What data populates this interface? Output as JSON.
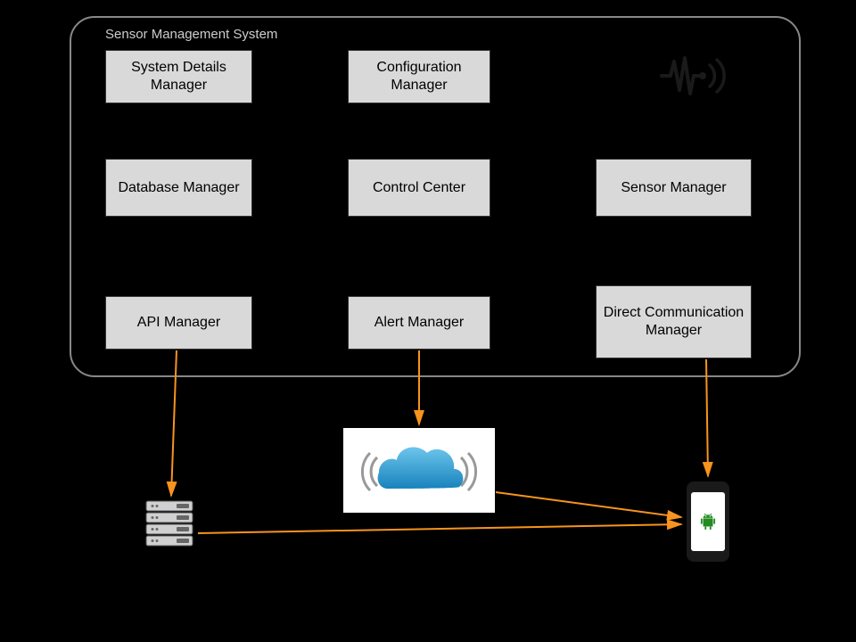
{
  "container": {
    "title": "Sensor Management System"
  },
  "boxes": {
    "system_details": "System Details Manager",
    "configuration": "Configuration Manager",
    "database": "Database Manager",
    "control_center": "Control Center",
    "sensor": "Sensor Manager",
    "api": "API Manager",
    "alert": "Alert Manager",
    "direct_comm": "Direct Communication Manager"
  },
  "icons": {
    "signal": "sensor-signal-icon",
    "cloud": "cloud-service-icon",
    "server": "server-icon",
    "phone": "android-phone-icon"
  },
  "colors": {
    "arrow": "#f7941d",
    "box_bg": "#d9d9d9",
    "cloud": "#2e9cd6"
  }
}
